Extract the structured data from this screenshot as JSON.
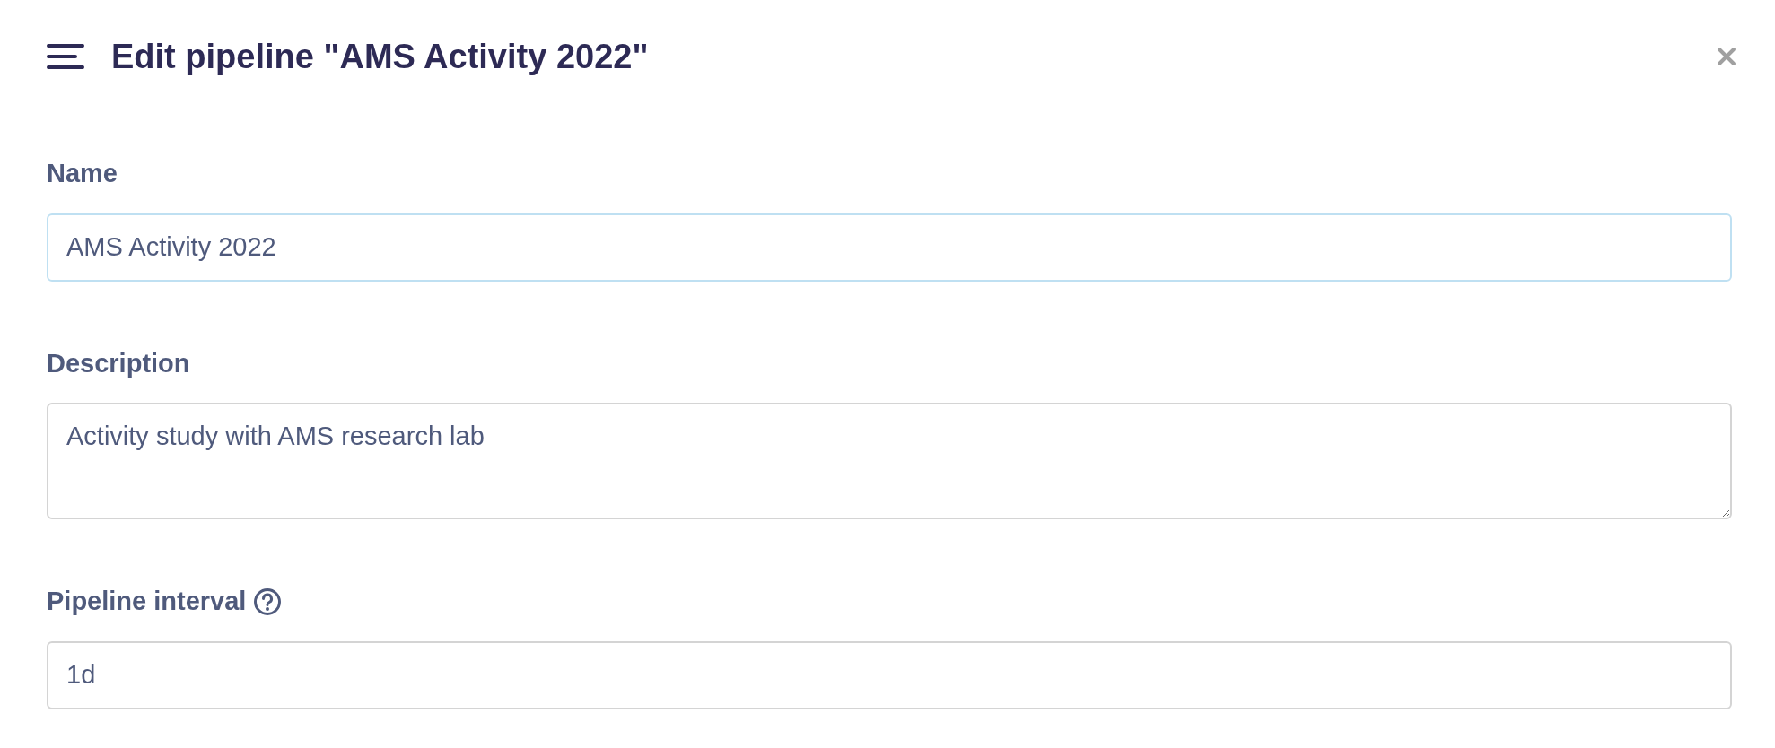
{
  "header": {
    "title": "Edit pipeline \"AMS Activity 2022\""
  },
  "fields": [
    {
      "kind": "input",
      "label": "Name",
      "value": "AMS Activity 2022",
      "focused": true,
      "help": false
    },
    {
      "kind": "textarea",
      "label": "Description",
      "value": "Activity study with AMS research lab",
      "focused": false,
      "help": false
    },
    {
      "kind": "input",
      "label": "Pipeline interval",
      "value": "1d",
      "focused": false,
      "help": true
    }
  ]
}
